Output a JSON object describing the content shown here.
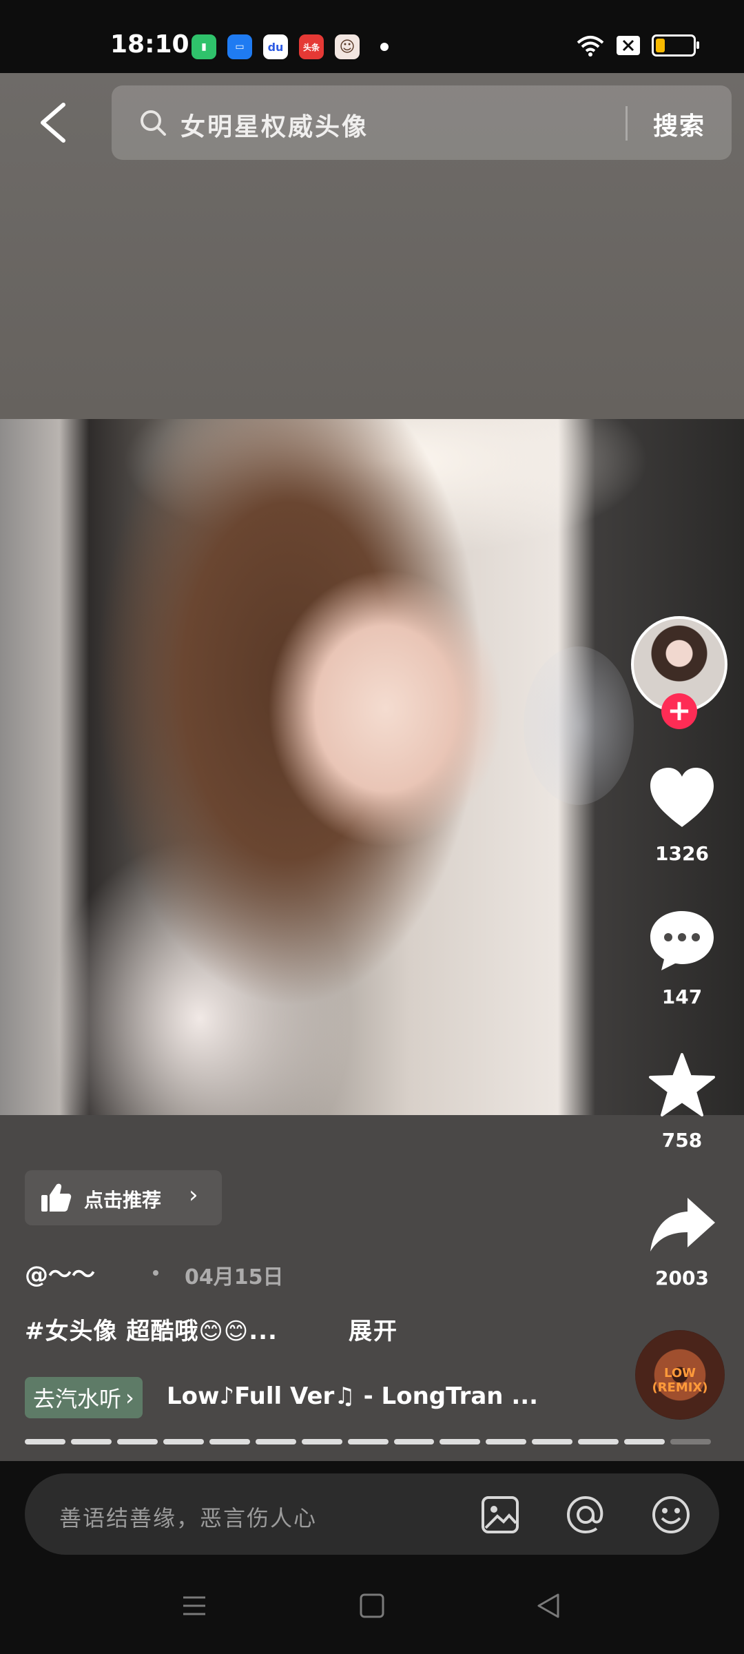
{
  "status_bar": {
    "time": "18:10",
    "apps": [
      {
        "name": "battery-app-icon",
        "color": "#2fc26b",
        "glyph": "▮"
      },
      {
        "name": "files-app-icon",
        "color": "#1f7bf2",
        "glyph": "▭"
      },
      {
        "name": "baidu-app-icon",
        "color": "#ffffff",
        "glyph": "du"
      },
      {
        "name": "toutiao-app-icon",
        "color": "#e53935",
        "glyph": "头条"
      },
      {
        "name": "avatar-app-icon",
        "color": "#f2e6e1",
        "glyph": "☺"
      }
    ]
  },
  "search": {
    "query": "女明星权威头像",
    "button": "搜索"
  },
  "rail": {
    "likes": "1326",
    "comments": "147",
    "favorites": "758",
    "shares": "2003",
    "follow": "+"
  },
  "post": {
    "recommend_label": "点击推荐",
    "author": "@～～",
    "date": "04月15日",
    "caption": "#女头像 超酷哦😊😊...",
    "expand": "展开",
    "music_tag": "去汽水听",
    "music_title": "Low♪Full Ver♫ - LongTran ...",
    "disc_text": "LOW (REMIX)",
    "progress_segments": 15,
    "progress_watched": 14
  },
  "comment": {
    "placeholder": "善语结善缘，恶言伤人心"
  },
  "colors": {
    "follow": "#fe2c55",
    "music_tag": "#5e7b67",
    "battery_fill": "#f7b900"
  }
}
